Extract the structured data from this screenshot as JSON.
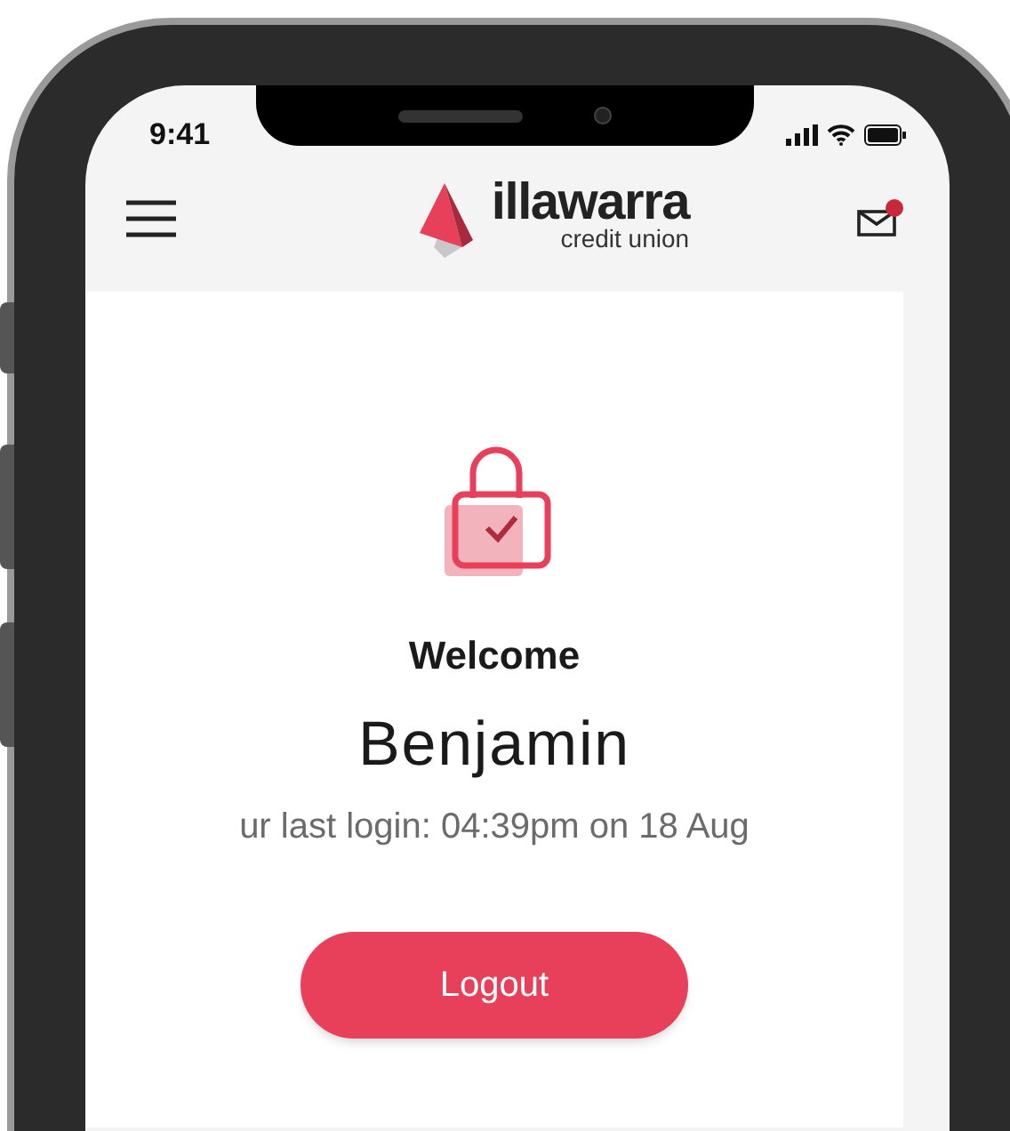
{
  "status_bar": {
    "time": "9:41"
  },
  "header": {
    "logo": {
      "name": "illawarra",
      "tagline": "credit union"
    },
    "mail": {
      "unread": true
    }
  },
  "greeting": {
    "title": "Welcome",
    "name": "Benjamin",
    "last_login": "ur last login: 04:39pm on 18 Aug"
  },
  "buttons": [
    {
      "label": "Logout"
    }
  ]
}
